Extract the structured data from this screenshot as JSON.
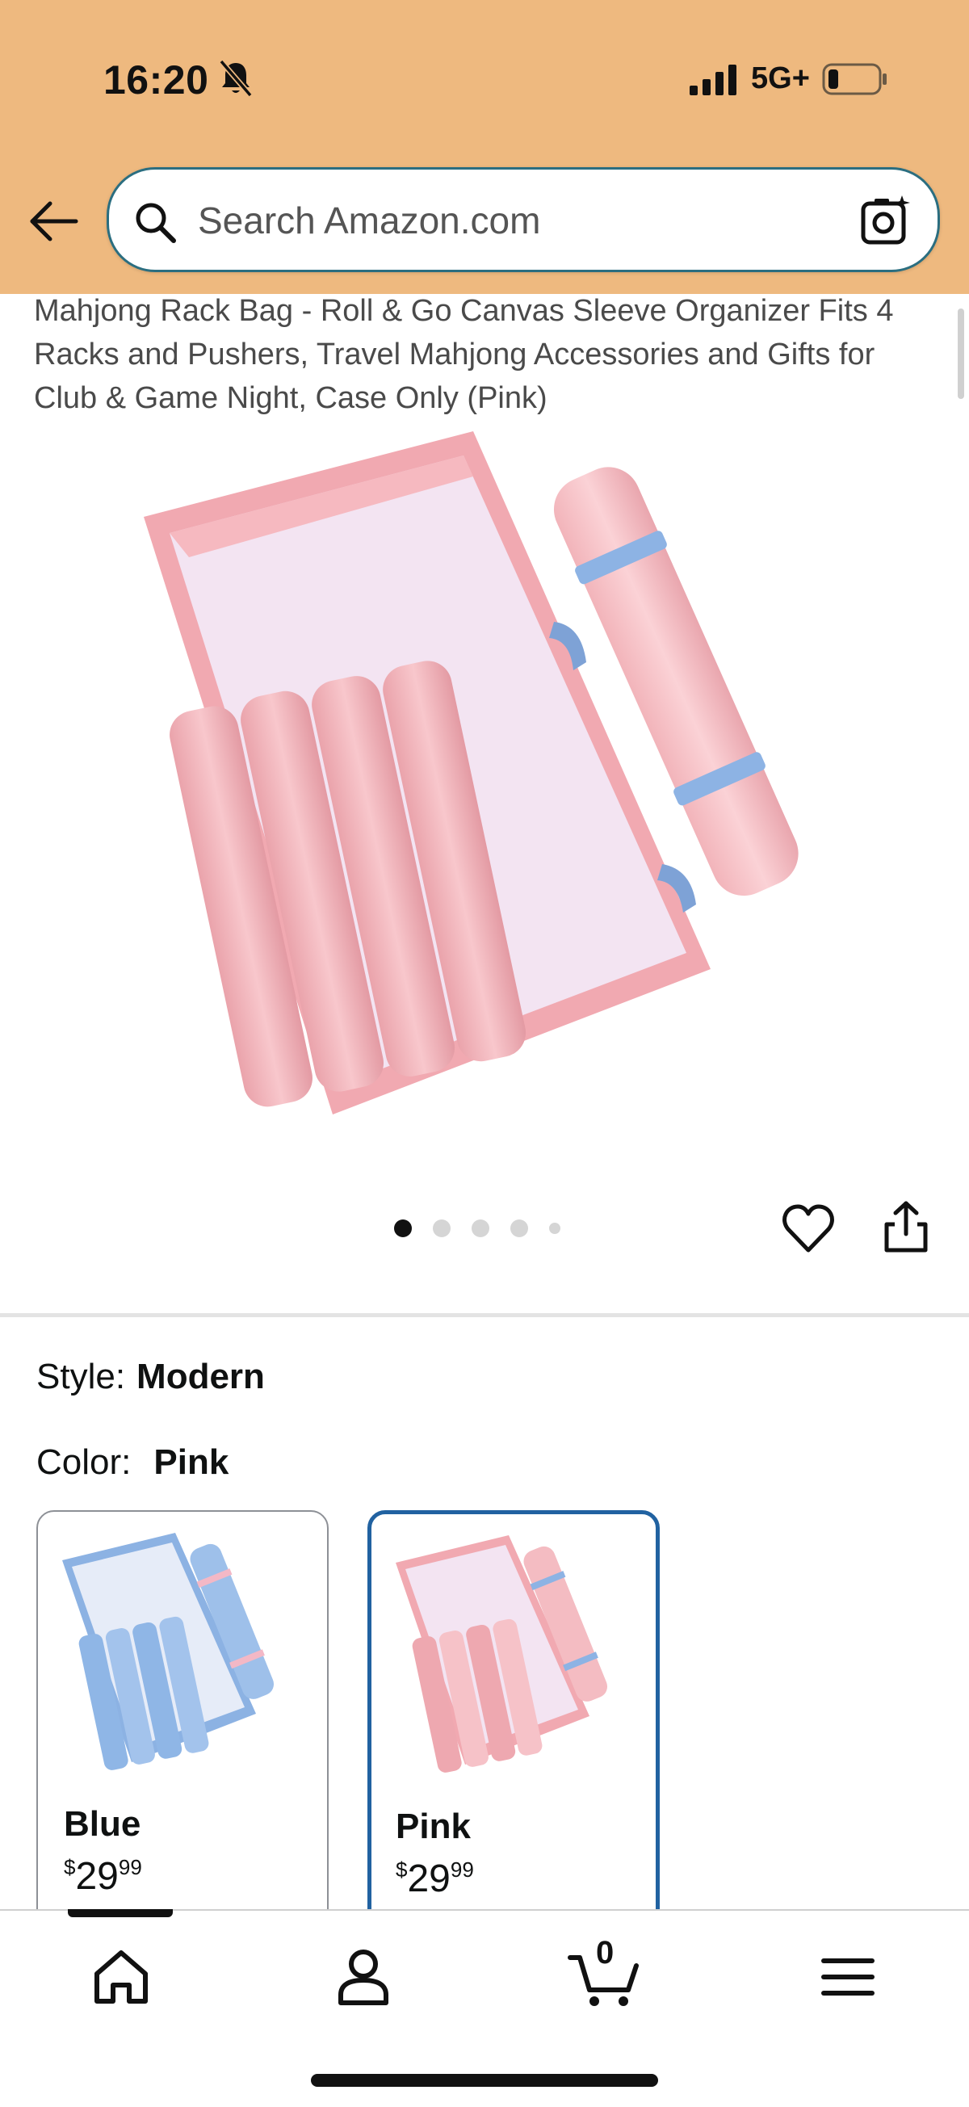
{
  "status_bar": {
    "time": "16:20",
    "network": "5G+"
  },
  "header": {
    "background_color": "#EEB97F",
    "search_placeholder": "Search Amazon.com",
    "icons": [
      "back-arrow-icon",
      "search-icon",
      "camera-lens-icon"
    ]
  },
  "product": {
    "title": "Mahjong Rack Bag - Roll & Go Canvas Sleeve Organizer Fits 4 Racks and Pushers, Travel Mahjong Accessories and Gifts for Club & Game Night, Case Only (Pink)",
    "image_count": 5,
    "active_image": 1
  },
  "variations": {
    "style_label": "Style:",
    "style_value": "Modern",
    "color_label": "Color:",
    "color_value": "Pink",
    "swatches": [
      {
        "name": "Blue",
        "price_symbol": "$",
        "price_whole": "29",
        "price_fraction": "99",
        "selected": false
      },
      {
        "name": "Pink",
        "price_symbol": "$",
        "price_whole": "29",
        "price_fraction": "99",
        "selected": true
      }
    ],
    "selected_border_color": "#2162A1"
  },
  "bottom_nav": {
    "cart_count": "0",
    "items": [
      "home-icon",
      "account-icon",
      "cart-icon",
      "menu-icon"
    ]
  }
}
